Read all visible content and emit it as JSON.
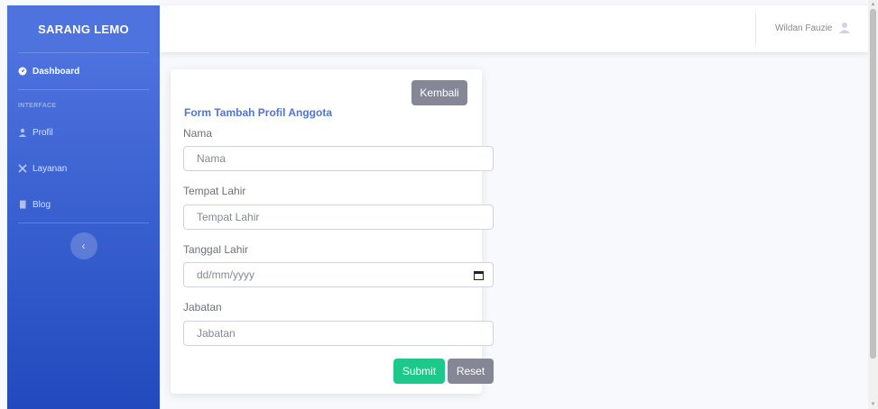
{
  "brand": "SARANG LEMO",
  "sidebar": {
    "items": [
      {
        "label": "Dashboard",
        "icon": "tachometer-icon"
      },
      {
        "label": "Profil",
        "icon": "user-icon"
      },
      {
        "label": "Layanan",
        "icon": "tools-icon"
      },
      {
        "label": "Blog",
        "icon": "file-icon"
      }
    ],
    "heading": "INTERFACE",
    "toggle": "‹"
  },
  "topbar": {
    "user_name": "Wildan Fauzie"
  },
  "form": {
    "back_label": "Kembali",
    "title": "Form Tambah Profil Anggota",
    "fields": [
      {
        "label": "Nama",
        "placeholder": "Nama"
      },
      {
        "label": "Tempat Lahir",
        "placeholder": "Tempat Lahir"
      },
      {
        "label": "Tanggal Lahir",
        "placeholder": "dd/mm/yyyy"
      },
      {
        "label": "Jabatan",
        "placeholder": "Jabatan"
      }
    ],
    "submit_label": "Submit",
    "reset_label": "Reset"
  },
  "colors": {
    "primary": "#4e73df",
    "success": "#1cc88a",
    "secondary": "#858796"
  }
}
